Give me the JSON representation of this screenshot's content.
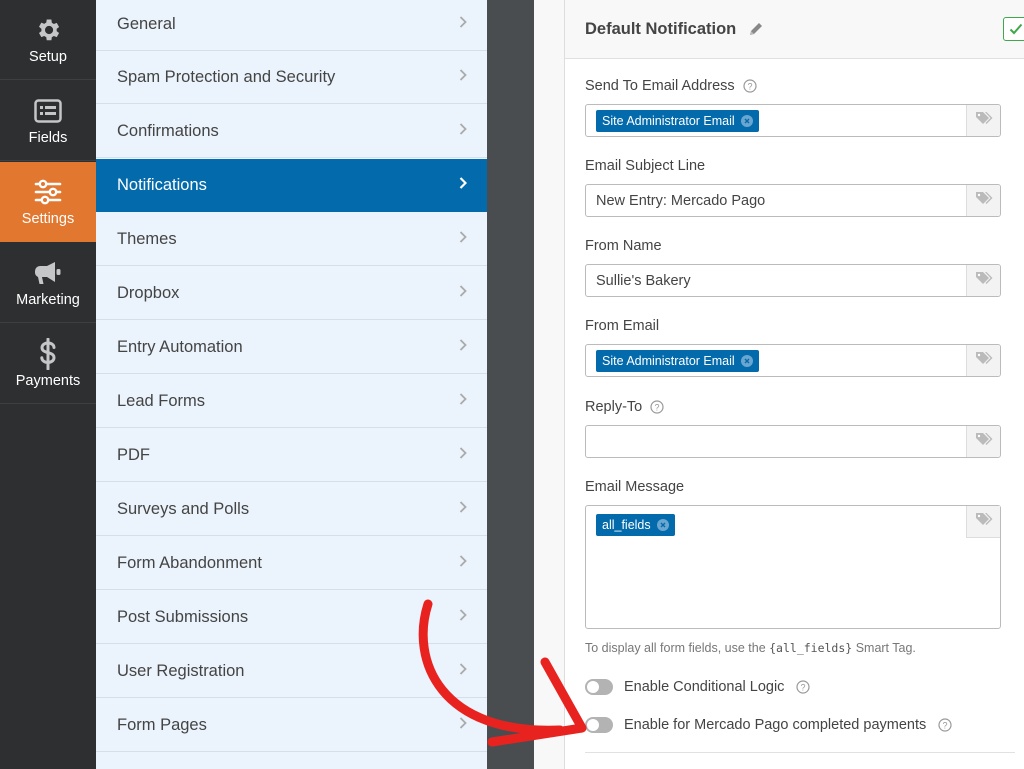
{
  "rail": [
    {
      "label": "Setup",
      "icon": "gear-icon"
    },
    {
      "label": "Fields",
      "icon": "list-icon"
    },
    {
      "label": "Settings",
      "icon": "sliders-icon"
    },
    {
      "label": "Marketing",
      "icon": "megaphone-icon"
    },
    {
      "label": "Payments",
      "icon": "dollar-icon"
    }
  ],
  "settings_menu": [
    {
      "label": "General"
    },
    {
      "label": "Spam Protection and Security"
    },
    {
      "label": "Confirmations"
    },
    {
      "label": "Notifications"
    },
    {
      "label": "Themes"
    },
    {
      "label": "Dropbox"
    },
    {
      "label": "Entry Automation"
    },
    {
      "label": "Lead Forms"
    },
    {
      "label": "PDF"
    },
    {
      "label": "Surveys and Polls"
    },
    {
      "label": "Form Abandonment"
    },
    {
      "label": "Post Submissions"
    },
    {
      "label": "User Registration"
    },
    {
      "label": "Form Pages"
    }
  ],
  "notification": {
    "title": "Default Notification",
    "send_to_label": "Send To Email Address",
    "send_to_chip": "Site Administrator Email",
    "subject_label": "Email Subject Line",
    "subject_value": "New Entry: Mercado Pago",
    "from_name_label": "From Name",
    "from_name_value": "Sullie's Bakery",
    "from_email_label": "From Email",
    "from_email_chip": "Site Administrator Email",
    "reply_to_label": "Reply-To",
    "reply_to_value": "",
    "message_label": "Email Message",
    "message_chip": "all_fields",
    "hint_before": "To display all form fields, use the ",
    "hint_code": "{all_fields}",
    "hint_after": " Smart Tag.",
    "conditional_label": "Enable Conditional Logic",
    "mercado_label": "Enable for Mercado Pago completed payments"
  },
  "colors": {
    "accent_orange": "#e27730",
    "accent_blue": "#036aab",
    "arrow_red": "#e8231f"
  }
}
